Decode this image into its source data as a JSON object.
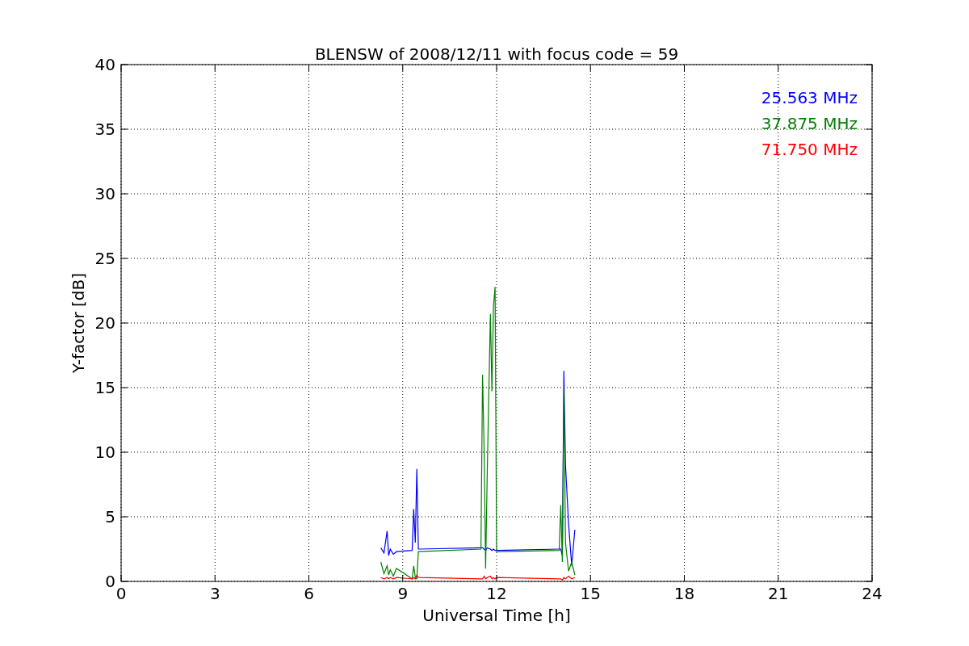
{
  "chart_data": {
    "type": "line",
    "grid": true,
    "title": "BLENSW of 2008/12/11 with focus code = 59",
    "xlabel": "Universal Time [h]",
    "ylabel": "Y-factor [dB]",
    "x": [
      8.3,
      8.4,
      8.5,
      8.55,
      8.6,
      8.7,
      8.8,
      9.3,
      9.35,
      9.4,
      9.45,
      9.5,
      11.5,
      11.55,
      11.6,
      11.65,
      11.7,
      11.8,
      11.85,
      11.9,
      11.95,
      12.0,
      14.0,
      14.05,
      14.1,
      14.15,
      14.2,
      14.3,
      14.4,
      14.5
    ],
    "series": [
      {
        "name": "25.563 MHz",
        "color": "#0000ff",
        "values": [
          2.6,
          2.2,
          3.9,
          2.0,
          2.5,
          2.1,
          2.3,
          2.4,
          5.6,
          3.0,
          8.7,
          2.5,
          2.6,
          2.6,
          2.5,
          2.4,
          2.6,
          2.5,
          2.4,
          2.5,
          2.4,
          2.4,
          2.5,
          2.5,
          2.0,
          16.3,
          9.0,
          4.5,
          1.2,
          4.0
        ]
      },
      {
        "name": "37.875 MHz",
        "color": "#008000",
        "values": [
          1.5,
          0.6,
          1.2,
          0.5,
          0.9,
          0.4,
          1.0,
          0.2,
          1.2,
          0.3,
          0.2,
          2.3,
          2.5,
          16.0,
          10.3,
          1.0,
          8.4,
          20.7,
          14.7,
          21.3,
          22.8,
          2.3,
          2.4,
          5.9,
          1.5,
          14.9,
          3.0,
          0.8,
          1.5,
          0.5
        ]
      },
      {
        "name": "71.750 MHz",
        "color": "#ff0000",
        "values": [
          0.3,
          0.2,
          0.3,
          0.2,
          0.3,
          0.2,
          0.3,
          0.2,
          0.3,
          0.2,
          0.5,
          0.3,
          0.2,
          0.2,
          0.4,
          0.2,
          0.3,
          0.4,
          0.2,
          0.3,
          0.2,
          0.3,
          0.2,
          0.2,
          0.1,
          0.3,
          0.2,
          0.4,
          0.2,
          0.3
        ]
      }
    ],
    "xlim": [
      0,
      24
    ],
    "ylim": [
      0,
      40
    ],
    "xticks": [
      0,
      3,
      6,
      9,
      12,
      15,
      18,
      21,
      24
    ],
    "yticks": [
      0,
      5,
      10,
      15,
      20,
      25,
      30,
      35,
      40
    ]
  }
}
